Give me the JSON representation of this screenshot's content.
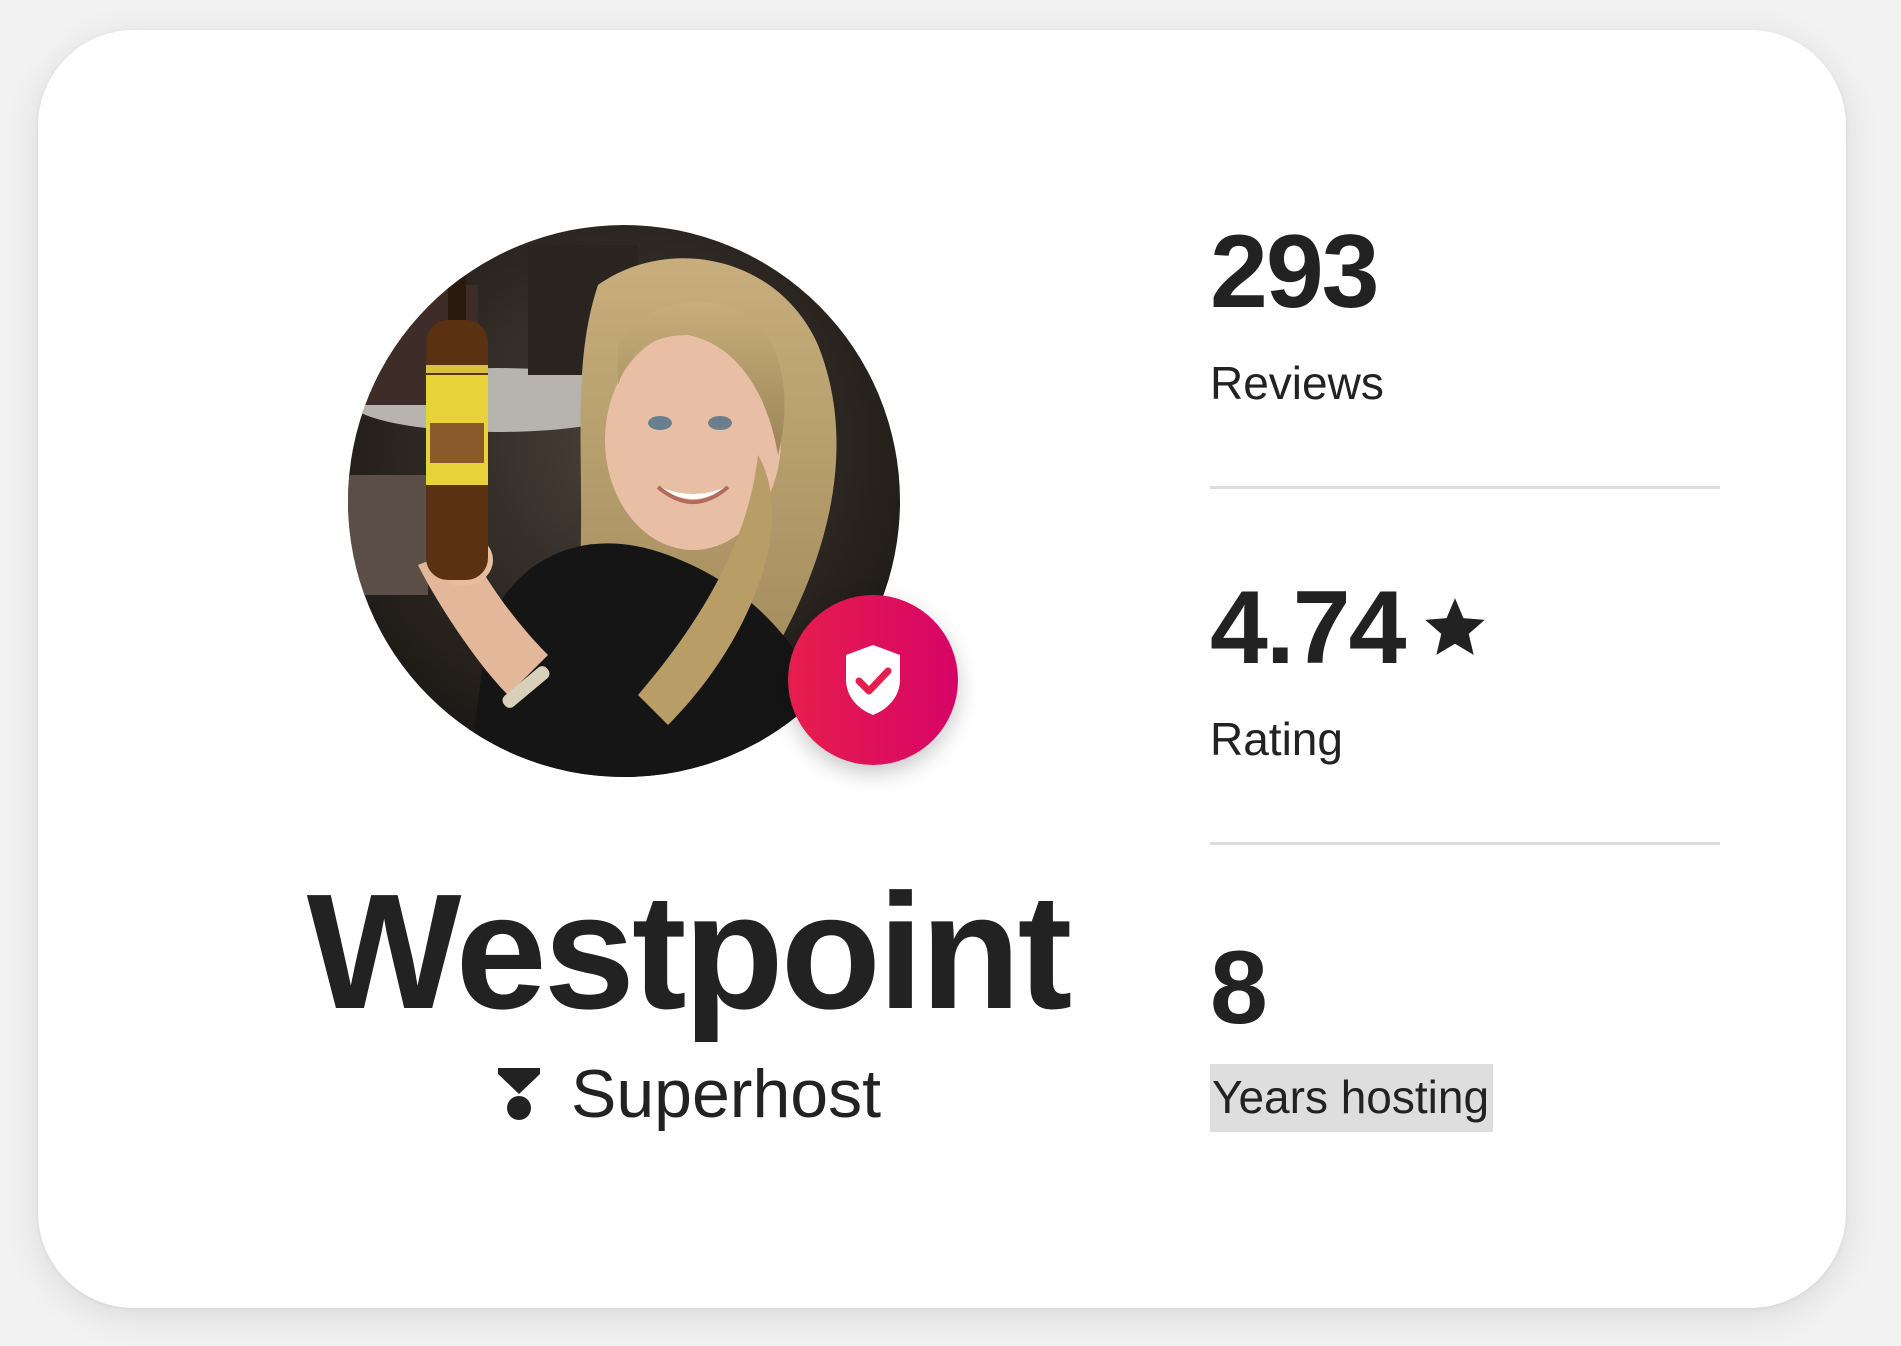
{
  "host": {
    "name": "Westpoint",
    "superhost_label": "Superhost",
    "verified": true,
    "badge_color": "#e61e4d"
  },
  "stats": [
    {
      "value": "293",
      "label": "Reviews"
    },
    {
      "value": "4.74",
      "label": "Rating",
      "icon": "star-icon"
    },
    {
      "value": "8",
      "label": "Years hosting"
    }
  ],
  "icons": {
    "verified": "shield-check-icon",
    "superhost": "superhost-badge-icon",
    "rating": "star-icon"
  },
  "colors": {
    "text": "#222222",
    "accent": "#e61e4d",
    "divider": "#dddddd"
  }
}
